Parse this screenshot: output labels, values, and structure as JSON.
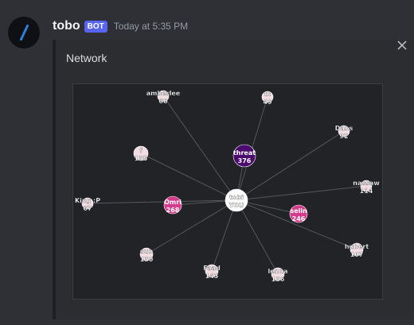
{
  "message": {
    "username": "tobo",
    "bot_tag": "BOT",
    "timestamp": "Today at 5:35 PM"
  },
  "embed": {
    "title": "Network"
  },
  "icons": {
    "avatar": "slash-logo-icon",
    "close": "close-icon"
  },
  "colors": {
    "background": "#313338",
    "bot_tag": "#5865f2",
    "center_node": "#ffffff",
    "top_node": "#4b0a6e",
    "pink_node": "#d63a8c",
    "light_node": "#f3dde3"
  },
  "network": {
    "center": {
      "name": "tobi",
      "value": "YOU"
    },
    "nodes": [
      {
        "name": "amberlee",
        "value": "60",
        "tier": "light"
      },
      {
        "name": "tc",
        "value": "49",
        "tier": "light"
      },
      {
        "name": "Dabs",
        "value": "92",
        "tier": "light"
      },
      {
        "name": "f",
        "value": "135",
        "tier": "light"
      },
      {
        "name": "threat",
        "value": "376",
        "tier": "top"
      },
      {
        "name": "nassaw",
        "value": "114",
        "tier": "light"
      },
      {
        "name": "King :P",
        "value": "67",
        "tier": "light"
      },
      {
        "name": "Omri",
        "value": "268",
        "tier": "pink"
      },
      {
        "name": "selin",
        "value": "246",
        "tier": "pink"
      },
      {
        "name": "sub",
        "value": "130",
        "tier": "light"
      },
      {
        "name": "Faad",
        "value": "143",
        "tier": "light"
      },
      {
        "name": "lenna",
        "value": "136",
        "tier": "light"
      },
      {
        "name": "hubert",
        "value": "107",
        "tier": "light"
      }
    ]
  }
}
